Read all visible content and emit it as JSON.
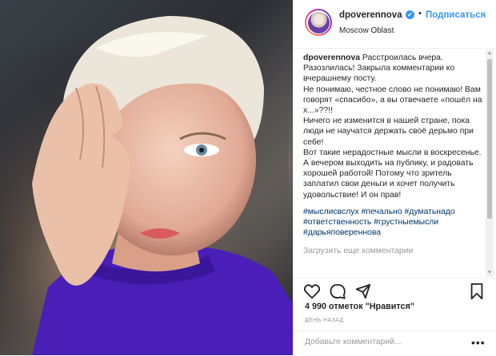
{
  "header": {
    "username": "dpoverennova",
    "verified_mark": "✔",
    "separator": "•",
    "follow_label": "Подписаться",
    "location": "Moscow Oblast"
  },
  "caption": {
    "username": "dpoverennova",
    "text": "Расстроилась вчера. Разозлилась! Закрыла комментарии ко вчерашнему посту.\nНе понимаю, честное слово не понимаю! Вам говорят «спасибо», а вы отвечаете «пошёл на х...»??!!\nНичего не изменится в нашей стране, пока люди не научатся держать своё дерьмо при себе!\nВот такие нерадостные мысли в воскресенье.\nА вечером выходить на публику, и радовать хорошей работой! Потому что зритель заплатил свои деньги и хочет получить удовольствие! И он прав!",
    "hashtags": [
      "#мыслисвслух",
      "#печально",
      "#думатьнадо",
      "#ответственность",
      "#грустныемысли",
      "#дарьяповереннова"
    ]
  },
  "load_more_label": "Загрузить еще комментарии",
  "likes_text": "4 990 отметок \"Нравится\"",
  "time_text": "ДЕНЬ НАЗАД",
  "add_comment_placeholder": "Добавьте комментарий...",
  "more_label": "•••",
  "icons": [
    "heart-icon",
    "comment-icon",
    "share-icon",
    "bookmark-icon",
    "verified-icon"
  ],
  "colors": {
    "accent": "#3897f0",
    "hashtag": "#003569",
    "muted": "#999999",
    "sweater": "#4a1fb8"
  }
}
